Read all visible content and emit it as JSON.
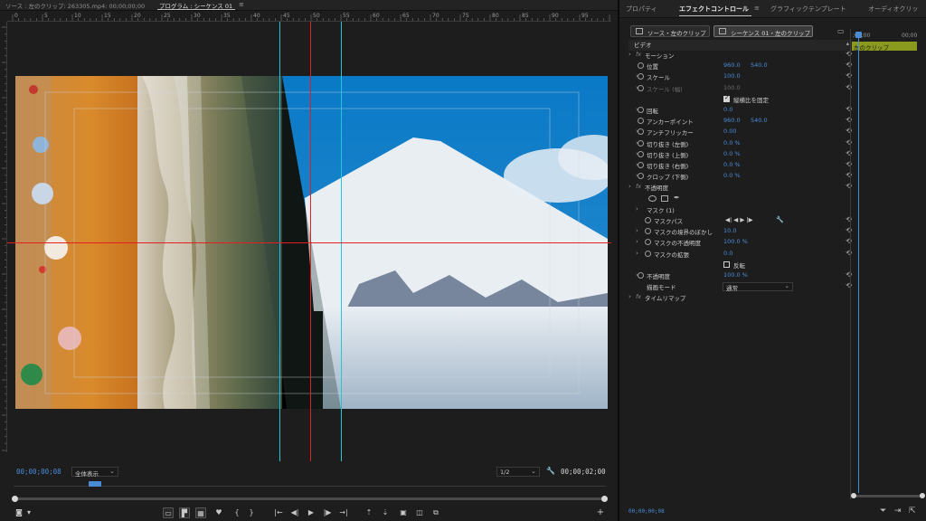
{
  "program": {
    "tabs": {
      "source": "ソース : 左のクリップ: 263305.mp4: 00;00;00;00",
      "program": "プログラム : シーケンス 01",
      "menu": "≡"
    },
    "ruler_labels": [
      "0",
      "5",
      "10",
      "15",
      "20",
      "25",
      "30",
      "35",
      "40",
      "45",
      "50",
      "55",
      "60",
      "65",
      "70",
      "75",
      "80",
      "85",
      "90",
      "95",
      "100"
    ],
    "current_time": "00;00;00;08",
    "fit_label": "全体表示",
    "resolution": "1/2",
    "duration": "00;00;02;00",
    "controls": {
      "mark_in": "▾",
      "mark_out": "{",
      "mark_out2": "}",
      "go_in": "|←",
      "step_back": "◀|",
      "play": "▶",
      "step_fwd": "|▶",
      "go_out": "→|",
      "plus": "+"
    }
  },
  "effects": {
    "tabs": [
      "プロパティ",
      "エフェクトコントロール",
      "≡",
      "グラフィックテンプレート",
      "オーディオクリッ"
    ],
    "clip_buttons": [
      "ソース・左のクリップ",
      "シーケンス 01・左のクリップ"
    ],
    "section_video": "ビデオ",
    "rows": [
      {
        "arrow": "›",
        "fx": "fx",
        "label": "モーション"
      },
      {
        "label": "位置",
        "v1": "960.0",
        "v2": "540.0"
      },
      {
        "arrow": "›",
        "label": "スケール",
        "v1": "100.0"
      },
      {
        "arrow": "›",
        "label": "スケール (幅)",
        "v1": "100.0",
        "dim": true
      },
      {
        "check": true,
        "label": "縦横比を固定"
      },
      {
        "arrow": "›",
        "label": "回転",
        "v1": "0.0"
      },
      {
        "label": "アンカーポイント",
        "v1": "960.0",
        "v2": "540.0"
      },
      {
        "arrow": "›",
        "label": "アンチフリッカー",
        "v1": "0.00"
      },
      {
        "arrow": "›",
        "label": "切り抜き (左側)",
        "v1": "0.0 %"
      },
      {
        "arrow": "›",
        "label": "切り抜き (上側)",
        "v1": "0.0 %"
      },
      {
        "arrow": "›",
        "label": "切り抜き (右側)",
        "v1": "0.0 %"
      },
      {
        "arrow": "›",
        "label": "クロップ (下側)",
        "v1": "0.0 %"
      },
      {
        "arrow": "›",
        "fx": "fx",
        "label": "不透明度"
      },
      {
        "shapes": true
      },
      {
        "arrow": "›",
        "label": "マスク (1)"
      },
      {
        "label": "マスクパス"
      },
      {
        "arrow": "›",
        "label": "マスクの境界のぼかし",
        "v1": "10.0"
      },
      {
        "arrow": "›",
        "label": "マスクの不透明度",
        "v1": "100.0 %"
      },
      {
        "arrow": "›",
        "label": "マスクの拡張",
        "v1": "0.0"
      },
      {
        "check": false,
        "label": "反転"
      },
      {
        "arrow": "›",
        "label": "不透明度",
        "v1": "100.0 %"
      },
      {
        "label": "描画モード",
        "select": "通常"
      },
      {
        "arrow": "›",
        "fx": "fx",
        "label": "タイムリマップ"
      }
    ],
    "mini_timeline": {
      "tc_left": ";00;00",
      "tc_right": "00;00",
      "clip_label": "左のクリップ"
    },
    "bottom_timecode": "00;00;00;08",
    "mask_path_controls": "◀| ◀ ▶ |▶"
  },
  "colors": {
    "accent_blue": "#4a8bd6",
    "guide_cyan": "#23c8d6",
    "guide_red": "#e31f1f",
    "clip_bar": "#8a9a1f"
  }
}
